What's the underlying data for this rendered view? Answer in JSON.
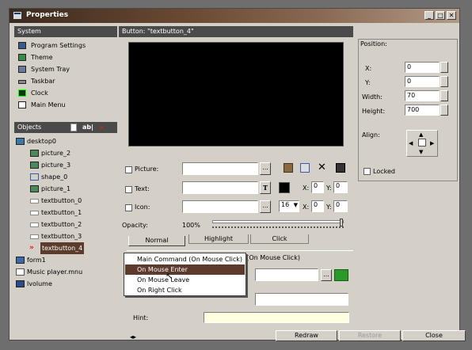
{
  "window": {
    "title": "Properties",
    "controls": {
      "minimize": "_",
      "maximize": "□",
      "close": "✕"
    }
  },
  "system": {
    "header": "System",
    "items": [
      {
        "label": "Program Settings",
        "icon": "settings-icon"
      },
      {
        "label": "Theme",
        "icon": "theme-icon"
      },
      {
        "label": "System Tray",
        "icon": "tray-icon"
      },
      {
        "label": "Taskbar",
        "icon": "taskbar-icon"
      },
      {
        "label": "Clock",
        "icon": "clock-icon"
      },
      {
        "label": "Main Menu",
        "icon": "menu-icon"
      }
    ]
  },
  "objects": {
    "header": "Objects",
    "toolbar_text_glyph": "ab|",
    "items": [
      {
        "label": "desktop0",
        "icon": "desktop-icon",
        "indent": 0
      },
      {
        "label": "picture_2",
        "icon": "picture-icon",
        "indent": 1
      },
      {
        "label": "picture_3",
        "icon": "picture-icon",
        "indent": 1
      },
      {
        "label": "shape_0",
        "icon": "shape-icon",
        "indent": 1
      },
      {
        "label": "picture_1",
        "icon": "picture-icon",
        "indent": 1
      },
      {
        "label": "textbutton_0",
        "icon": "textbutton-icon",
        "indent": 1
      },
      {
        "label": "textbutton_1",
        "icon": "textbutton-icon",
        "indent": 1
      },
      {
        "label": "textbutton_2",
        "icon": "textbutton-icon",
        "indent": 1
      },
      {
        "label": "textbutton_3",
        "icon": "textbutton-icon",
        "indent": 1
      },
      {
        "label": "textbutton_4",
        "icon": "textbutton-icon",
        "indent": 1,
        "selected": true
      },
      {
        "label": "form1",
        "icon": "form-icon",
        "indent": 0
      },
      {
        "label": "Music player.mnu",
        "icon": "menu-file-icon",
        "indent": 0
      },
      {
        "label": "lvolume",
        "icon": "volume-icon",
        "indent": 0
      }
    ]
  },
  "button_panel": {
    "header": "Button:  \"textbutton_4\"",
    "picture": {
      "label": "Picture:",
      "value": ""
    },
    "text": {
      "label": "Text:",
      "value": "",
      "bold_glyph": "T",
      "x_label": "X:",
      "x_value": "0",
      "y_label": "Y:",
      "y_value": "0"
    },
    "icon": {
      "label": "Icon:",
      "value": "",
      "size": "16",
      "x_label": "X:",
      "x_value": "0",
      "y_label": "Y:",
      "y_value": "0"
    },
    "opacity": {
      "label": "Opacity:",
      "value": "100%",
      "level": 1.0
    },
    "tabs": [
      "Normal",
      "Highlight",
      "Click"
    ],
    "command_header": "Main Command (On Mouse Click)",
    "hint_label": "Hint:",
    "hint_value": "",
    "browse": "...",
    "dropdown_arrow": "▼"
  },
  "position": {
    "title": "Position:",
    "x_label": "X:",
    "x_value": "0",
    "y_label": "Y:",
    "y_value": "0",
    "width_label": "Width:",
    "width_value": "70",
    "height_label": "Height:",
    "height_value": "700",
    "align_label": "Align:",
    "locked_label": "Locked"
  },
  "dropdown": {
    "items": [
      "Main Command (On Mouse Click)",
      "On Mouse Enter",
      "On Mouse Leave",
      "On Right Click"
    ],
    "selected_index": 1
  },
  "footer": {
    "nav_arrows": "◂▸",
    "redraw": "Redraw",
    "restore": "Restore",
    "close": "Close"
  },
  "colors": {
    "title_gradient_start": "#3c2a1e",
    "selection": "#5c3a2c",
    "hint_bg": "#ffffe0"
  }
}
